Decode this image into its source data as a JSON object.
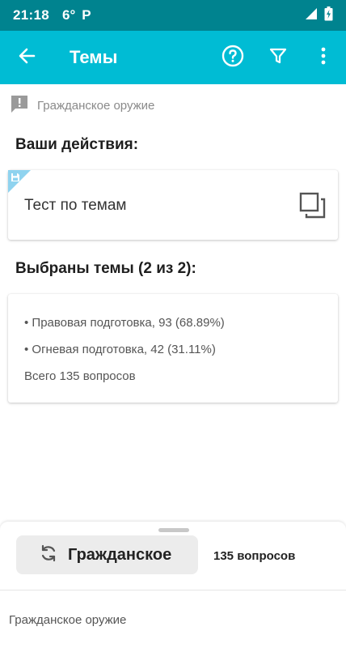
{
  "status_bar": {
    "time": "21:18",
    "temperature": "6°",
    "p_label": "P"
  },
  "app_bar": {
    "title": "Темы",
    "icons": [
      "back-arrow-icon",
      "help-circle-icon",
      "filter-icon",
      "more-vert-icon"
    ]
  },
  "category": {
    "label": "Гражданское оружие",
    "icon": "report-icon"
  },
  "actions": {
    "heading": "Ваши действия:",
    "items": [
      {
        "label": "Тест по темам",
        "icon": "copy-icon",
        "badge_icon": "save-icon"
      }
    ]
  },
  "selected": {
    "heading": "Выбраны темы (2 из 2):",
    "topics": [
      "• Правовая подготовка, 93 (68.89%)",
      "• Огневая подготовка, 42 (31.11%)"
    ],
    "total": "Всего 135 вопросов"
  },
  "bottom_sheet": {
    "button_label": "Гражданское",
    "button_icon": "refresh-icon",
    "count_label": "135 вопросов",
    "footer": "Гражданское оружие"
  },
  "colors": {
    "status_bar": "#00838f",
    "app_bar": "#00bcd4",
    "corner_badge": "#8fd3ef"
  }
}
